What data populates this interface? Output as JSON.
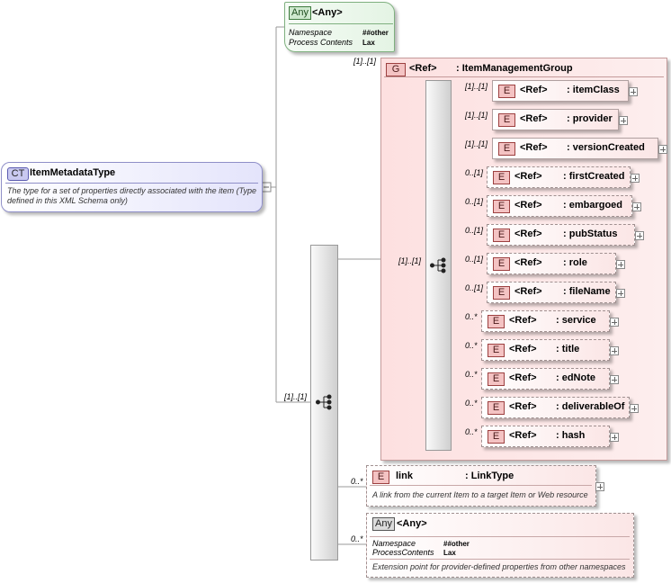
{
  "complex_type": {
    "badge": "CT",
    "name": "ItemMetadataType",
    "description": "The type for a set of properties directly associated with the item (Type defined in this XML Schema only)"
  },
  "top_any": {
    "badge": "Any",
    "title": "<Any>",
    "namespace_label": "Namespace",
    "namespace_value": "##other",
    "process_label": "Process Contents",
    "process_value": "Lax"
  },
  "group": {
    "badge": "G",
    "ref": "<Ref>",
    "name": ": ItemManagementGroup",
    "multiplicity": "[1]..[1]",
    "sequence_multiplicity": "[1]..[1]"
  },
  "main_sequence_multiplicity": "[1]..[1]",
  "group_elements": [
    {
      "badge": "E",
      "ref": "<Ref>",
      "name": ": itemClass",
      "mult": "[1]..[1]",
      "optional": false
    },
    {
      "badge": "E",
      "ref": "<Ref>",
      "name": ": provider",
      "mult": "[1]..[1]",
      "optional": false
    },
    {
      "badge": "E",
      "ref": "<Ref>",
      "name": ": versionCreated",
      "mult": "[1]..[1]",
      "optional": false
    },
    {
      "badge": "E",
      "ref": "<Ref>",
      "name": ": firstCreated",
      "mult": "0..[1]",
      "optional": true
    },
    {
      "badge": "E",
      "ref": "<Ref>",
      "name": ": embargoed",
      "mult": "0..[1]",
      "optional": true
    },
    {
      "badge": "E",
      "ref": "<Ref>",
      "name": ": pubStatus",
      "mult": "0..[1]",
      "optional": true
    },
    {
      "badge": "E",
      "ref": "<Ref>",
      "name": ": role",
      "mult": "0..[1]",
      "optional": true
    },
    {
      "badge": "E",
      "ref": "<Ref>",
      "name": ": fileName",
      "mult": "0..[1]",
      "optional": true
    },
    {
      "badge": "E",
      "ref": "<Ref>",
      "name": ": service",
      "mult": "0..*",
      "optional": true
    },
    {
      "badge": "E",
      "ref": "<Ref>",
      "name": ": title",
      "mult": "0..*",
      "optional": true
    },
    {
      "badge": "E",
      "ref": "<Ref>",
      "name": ": edNote",
      "mult": "0..*",
      "optional": true
    },
    {
      "badge": "E",
      "ref": "<Ref>",
      "name": ": deliverableOf",
      "mult": "0..*",
      "optional": true
    },
    {
      "badge": "E",
      "ref": "<Ref>",
      "name": ": hash",
      "mult": "0..*",
      "optional": true
    }
  ],
  "link": {
    "badge": "E",
    "name": "link",
    "type": ": LinkType",
    "multiplicity": "0..*",
    "description": "A link from the current Item to a target Item or Web resource"
  },
  "bottom_any": {
    "badge": "Any",
    "title": "<Any>",
    "multiplicity": "0..*",
    "namespace_label": "Namespace",
    "namespace_value": "##other",
    "process_label": "ProcessContents",
    "process_value": "Lax",
    "description": "Extension point for provider-defined properties from other namespaces"
  },
  "colors": {
    "element_fill": "#fbe6e6",
    "group_fill": "#fde3e3",
    "ct_fill": "#e4e4fb",
    "any_green": "#e4f4e4",
    "connector": "#9a9a9a"
  }
}
